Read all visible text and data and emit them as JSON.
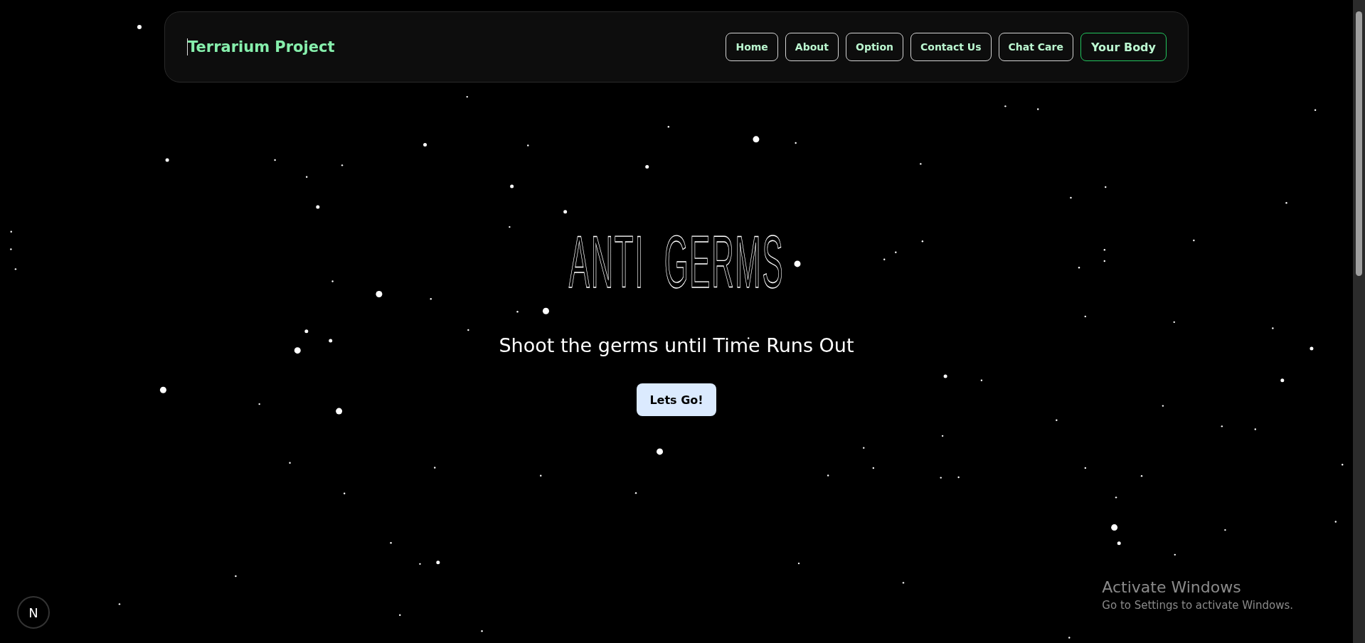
{
  "navbar": {
    "brand": "Terrarium Project",
    "links": [
      {
        "label": "Home",
        "selected": false
      },
      {
        "label": "About",
        "selected": false
      },
      {
        "label": "Option",
        "selected": false
      },
      {
        "label": "Contact Us",
        "selected": false
      },
      {
        "label": "Chat Care",
        "selected": false
      },
      {
        "label": "Your Body",
        "selected": true
      }
    ]
  },
  "hero": {
    "title": "ANTI  GERMS",
    "subtitle": "Shoot the germs until Time Runs Out",
    "button": "Lets Go!"
  },
  "dev_badge": "N",
  "activation_notice": {
    "title": "Activate Windows",
    "text": "Go to Settings to activate Windows."
  }
}
